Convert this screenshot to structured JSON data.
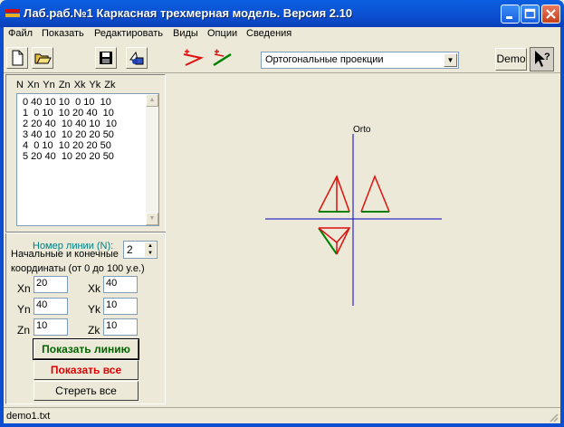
{
  "window": {
    "title": "Лаб.раб.№1 Каркасная трехмерная модель. Версия 2.10"
  },
  "menu": [
    "Файл",
    "Показать",
    "Редактировать",
    "Виды",
    "Опции",
    "Сведения"
  ],
  "toolbar": {
    "projection": "Ортогональные проекции",
    "demo_label": "Demo"
  },
  "table": {
    "header": "N  Xn  Yn  Zn  Xk  Yk  Zk",
    "rows": [
      "0 40 10 10  0 10  10",
      "1  0 10  10 20 40  10",
      "2 20 40  10 40 10  10",
      "3 40 10  10 20 20 50",
      "4  0 10  10 20 20 50",
      "5 20 40  10 20 20 50"
    ]
  },
  "editor": {
    "line_number_label": "Номер линии (N):",
    "line_number": "2",
    "coords_label_1": "Начальные и конечные",
    "coords_label_2": "координаты (от 0 до 100 у.е.)",
    "fields": [
      {
        "label": "Xn",
        "value": "20"
      },
      {
        "label": "Xk",
        "value": "40"
      },
      {
        "label": "Yn",
        "value": "40"
      },
      {
        "label": "Yk",
        "value": "10"
      },
      {
        "label": "Zn",
        "value": "10"
      },
      {
        "label": "Zk",
        "value": "10"
      }
    ],
    "show_line": "Показать линию",
    "show_all": "Показать все",
    "clear_all": "Стереть все"
  },
  "canvas": {
    "axis_label": "Orto"
  },
  "status": {
    "file": "demo1.txt"
  },
  "colors": {
    "axis": "#0000c0",
    "edge_red": "#e01010",
    "edge_green": "#008000",
    "title_bar": "#0a5fe0"
  }
}
